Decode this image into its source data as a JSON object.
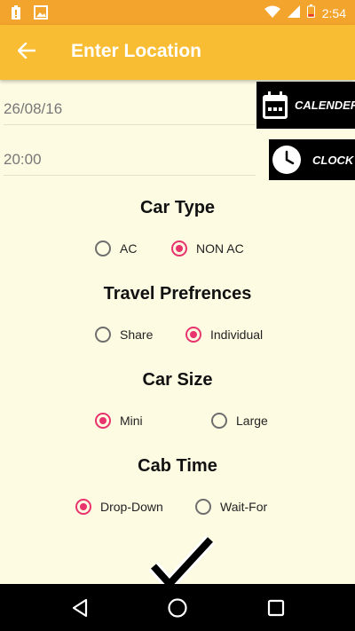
{
  "status_bar": {
    "time": "2:54",
    "icons": [
      "battery-alert-icon",
      "image-icon",
      "wifi-icon",
      "signal-icon",
      "battery-low-icon"
    ]
  },
  "app_bar": {
    "title": "Enter Location",
    "back_icon": "arrow-left-icon"
  },
  "date_field": {
    "value": "26/08/16"
  },
  "time_field": {
    "value": "20:00"
  },
  "calendar_button": {
    "label": "CALENDER",
    "icon": "calendar-icon"
  },
  "clock_button": {
    "label": "CLOCK",
    "icon": "clock-icon"
  },
  "sections": [
    {
      "title": "Car Type",
      "options": [
        {
          "label": "AC",
          "checked": false
        },
        {
          "label": "NON AC",
          "checked": true
        }
      ]
    },
    {
      "title": "Travel Prefrences",
      "options": [
        {
          "label": "Share",
          "checked": false
        },
        {
          "label": "Individual",
          "checked": true
        }
      ]
    },
    {
      "title": "Car Size",
      "options": [
        {
          "label": "Mini",
          "checked": true
        },
        {
          "label": "Large",
          "checked": false
        }
      ]
    },
    {
      "title": "Cab Time",
      "options": [
        {
          "label": "Drop-Down",
          "checked": true
        },
        {
          "label": "Wait-For",
          "checked": false
        }
      ]
    }
  ],
  "submit": {
    "icon": "checkmark-icon"
  },
  "nav_bar": {
    "icons": [
      "back-triangle-icon",
      "home-circle-icon",
      "recents-square-icon"
    ]
  },
  "colors": {
    "status_bar": "#f2a42c",
    "app_bar": "#f8bd33",
    "background": "#fefbe3",
    "accent": "#e8336d"
  }
}
